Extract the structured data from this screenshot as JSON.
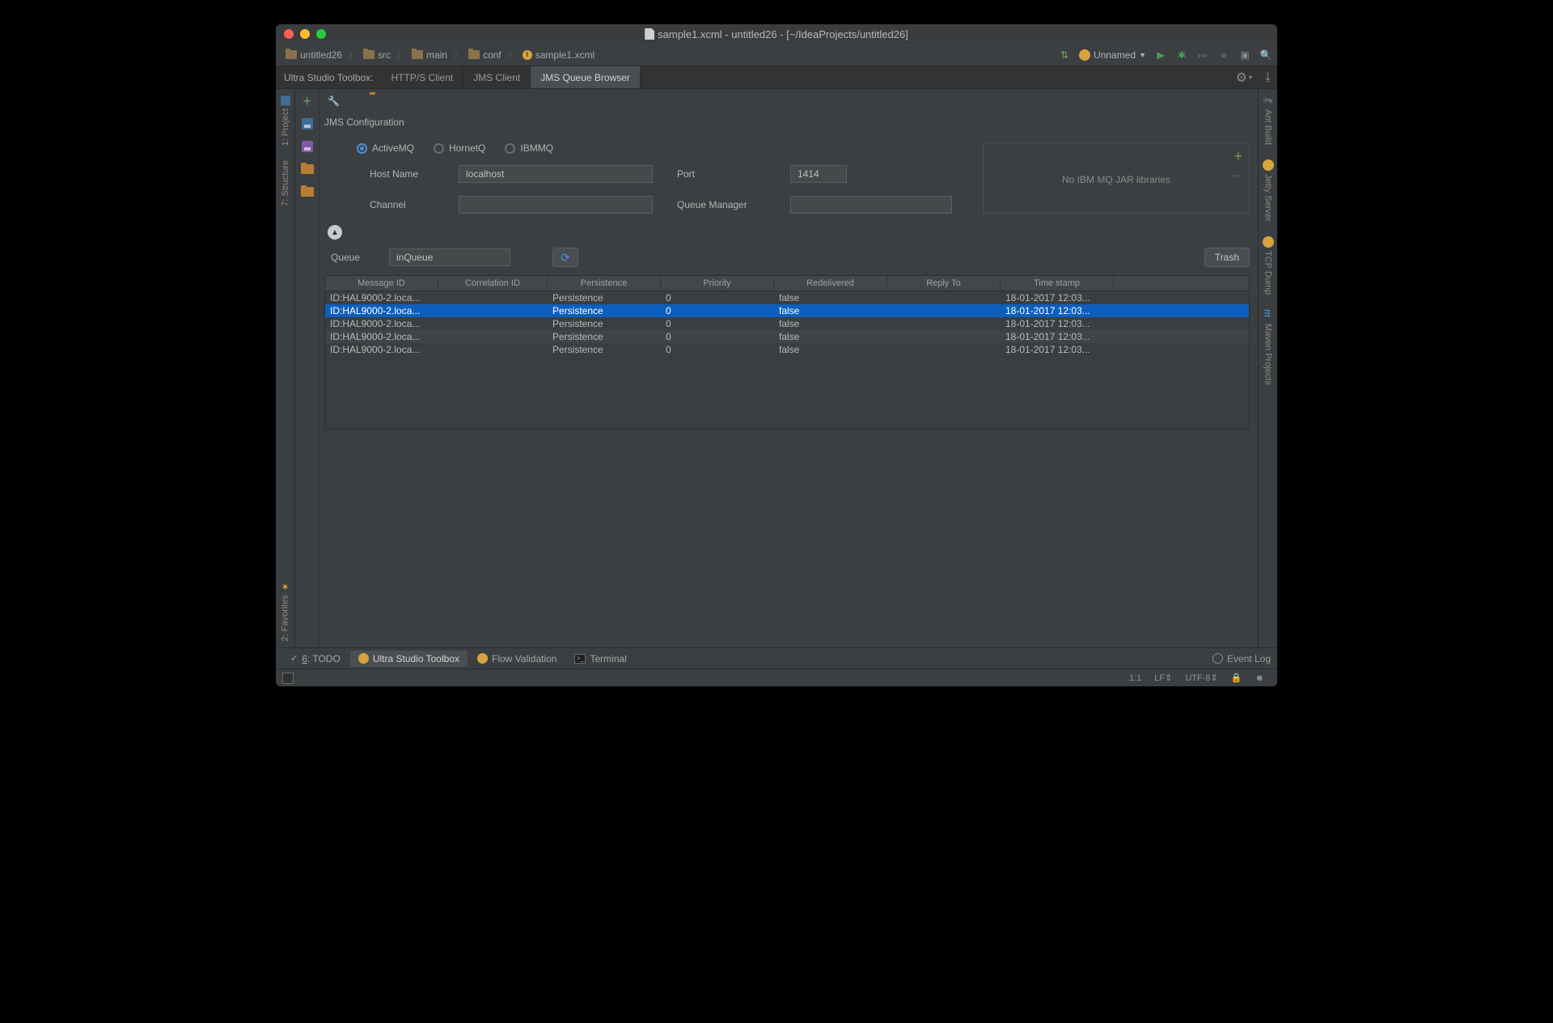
{
  "title": "sample1.xcml - untitled26 - [~/IdeaProjects/untitled26]",
  "breadcrumbs": [
    "untitled26",
    "src",
    "main",
    "conf",
    "sample1.xcml"
  ],
  "runConfig": "Unnamed",
  "toolbox": {
    "label": "Ultra Studio Toolbox:",
    "tabs": [
      "HTTP/S Client",
      "JMS Client",
      "JMS Queue Browser"
    ]
  },
  "leftGutter": {
    "project": "1: Project",
    "structure": "7: Structure",
    "favorites": "2: Favorites"
  },
  "rightGutter": {
    "ant": "Ant Build",
    "jetty": "Jetty Server",
    "tcp": "TCP Dump",
    "maven": "Maven Projects"
  },
  "config": {
    "title": "JMS Configuration",
    "radios": {
      "activemq": "ActiveMQ",
      "hornetq": "HornetQ",
      "ibmmq": "IBMMQ"
    },
    "hostLabel": "Host Name",
    "hostValue": "localhost",
    "portLabel": "Port",
    "portValue": "1414",
    "channelLabel": "Channel",
    "channelValue": "",
    "qmLabel": "Queue Manager",
    "qmValue": "",
    "libMessage": "No IBM MQ JAR libraries"
  },
  "queue": {
    "label": "Queue",
    "value": "inQueue",
    "trash": "Trash"
  },
  "table": {
    "headers": [
      "Message ID",
      "Correlation ID",
      "Persistence",
      "Priority",
      "Redelivered",
      "Reply To",
      "Time stamp"
    ],
    "rows": [
      {
        "id": "ID:HAL9000-2.loca...",
        "corr": "",
        "pers": "Persistence",
        "prio": "0",
        "redel": "false",
        "reply": "",
        "ts": "18-01-2017 12:03...",
        "selected": false
      },
      {
        "id": "ID:HAL9000-2.loca...",
        "corr": "",
        "pers": "Persistence",
        "prio": "0",
        "redel": "false",
        "reply": "",
        "ts": "18-01-2017 12:03...",
        "selected": true
      },
      {
        "id": "ID:HAL9000-2.loca...",
        "corr": "",
        "pers": "Persistence",
        "prio": "0",
        "redel": "false",
        "reply": "",
        "ts": "18-01-2017 12:03...",
        "selected": false
      },
      {
        "id": "ID:HAL9000-2.loca...",
        "corr": "",
        "pers": "Persistence",
        "prio": "0",
        "redel": "false",
        "reply": "",
        "ts": "18-01-2017 12:03...",
        "selected": false
      },
      {
        "id": "ID:HAL9000-2.loca...",
        "corr": "",
        "pers": "Persistence",
        "prio": "0",
        "redel": "false",
        "reply": "",
        "ts": "18-01-2017 12:03...",
        "selected": false
      }
    ]
  },
  "bottomTabs": {
    "todo": "6: TODO",
    "toolbox": "Ultra Studio Toolbox",
    "flow": "Flow Validation",
    "terminal": "Terminal",
    "eventLog": "Event Log"
  },
  "status": {
    "pos": "1:1",
    "lf": "LF",
    "enc": "UTF-8"
  }
}
